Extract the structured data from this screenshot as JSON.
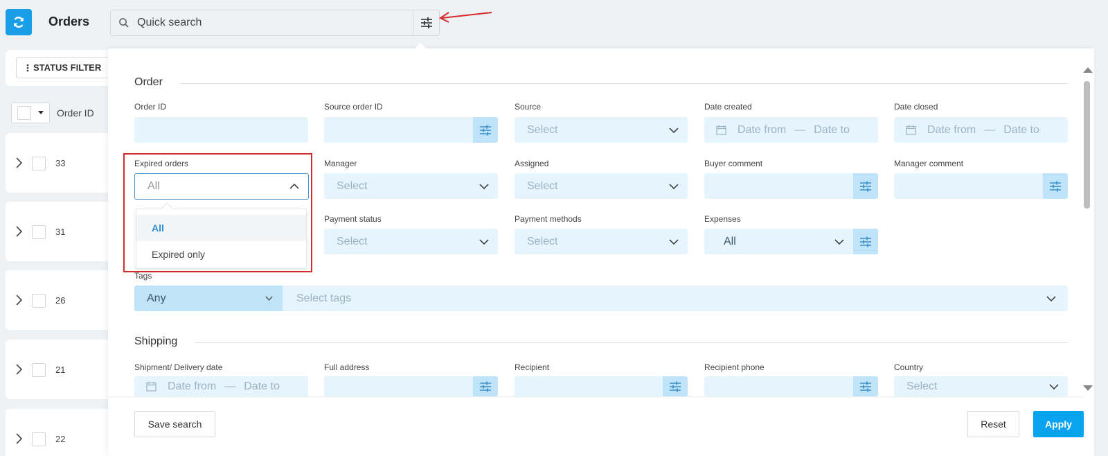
{
  "header": {
    "title": "Orders",
    "search_placeholder": "Quick search"
  },
  "sidebar": {
    "status_filter_label": "STATUS FILTER",
    "column_label": "Order ID",
    "orders": [
      "33",
      "31",
      "26",
      "21",
      "22"
    ]
  },
  "filter_panel": {
    "order_section_title": "Order",
    "shipping_section_title": "Shipping",
    "fields": {
      "order_id": {
        "label": "Order ID"
      },
      "source_order_id": {
        "label": "Source order ID"
      },
      "source": {
        "label": "Source",
        "placeholder": "Select"
      },
      "date_created": {
        "label": "Date created",
        "from": "Date from",
        "dash": "—",
        "to": "Date to"
      },
      "date_closed": {
        "label": "Date closed",
        "from": "Date from",
        "dash": "—",
        "to": "Date to"
      },
      "expired_orders": {
        "label": "Expired orders",
        "value": "All",
        "options": [
          "All",
          "Expired only"
        ]
      },
      "manager": {
        "label": "Manager",
        "placeholder": "Select"
      },
      "assigned": {
        "label": "Assigned",
        "placeholder": "Select"
      },
      "buyer_comment": {
        "label": "Buyer comment"
      },
      "manager_comment": {
        "label": "Manager comment"
      },
      "payment_status": {
        "label": "Payment status",
        "placeholder": "Select"
      },
      "payment_methods": {
        "label": "Payment methods",
        "placeholder": "Select"
      },
      "expenses": {
        "label": "Expenses",
        "value": "All"
      },
      "tags": {
        "label": "Tags",
        "mode": "Any",
        "placeholder": "Select tags"
      },
      "shipment_date": {
        "label": "Shipment/ Delivery date",
        "from": "Date from",
        "dash": "—",
        "to": "Date to"
      },
      "full_address": {
        "label": "Full address"
      },
      "recipient": {
        "label": "Recipient"
      },
      "recipient_phone": {
        "label": "Recipient phone"
      },
      "country": {
        "label": "Country",
        "placeholder": "Select"
      }
    },
    "buttons": {
      "save": "Save search",
      "reset": "Reset",
      "apply": "Apply"
    }
  },
  "colors": {
    "accent": "#0aa3ef",
    "field_bg": "#e5f4fd",
    "addon_bg": "#bfe3f8",
    "highlight": "#d42a2a",
    "selected_option": "#2a8fd9"
  }
}
